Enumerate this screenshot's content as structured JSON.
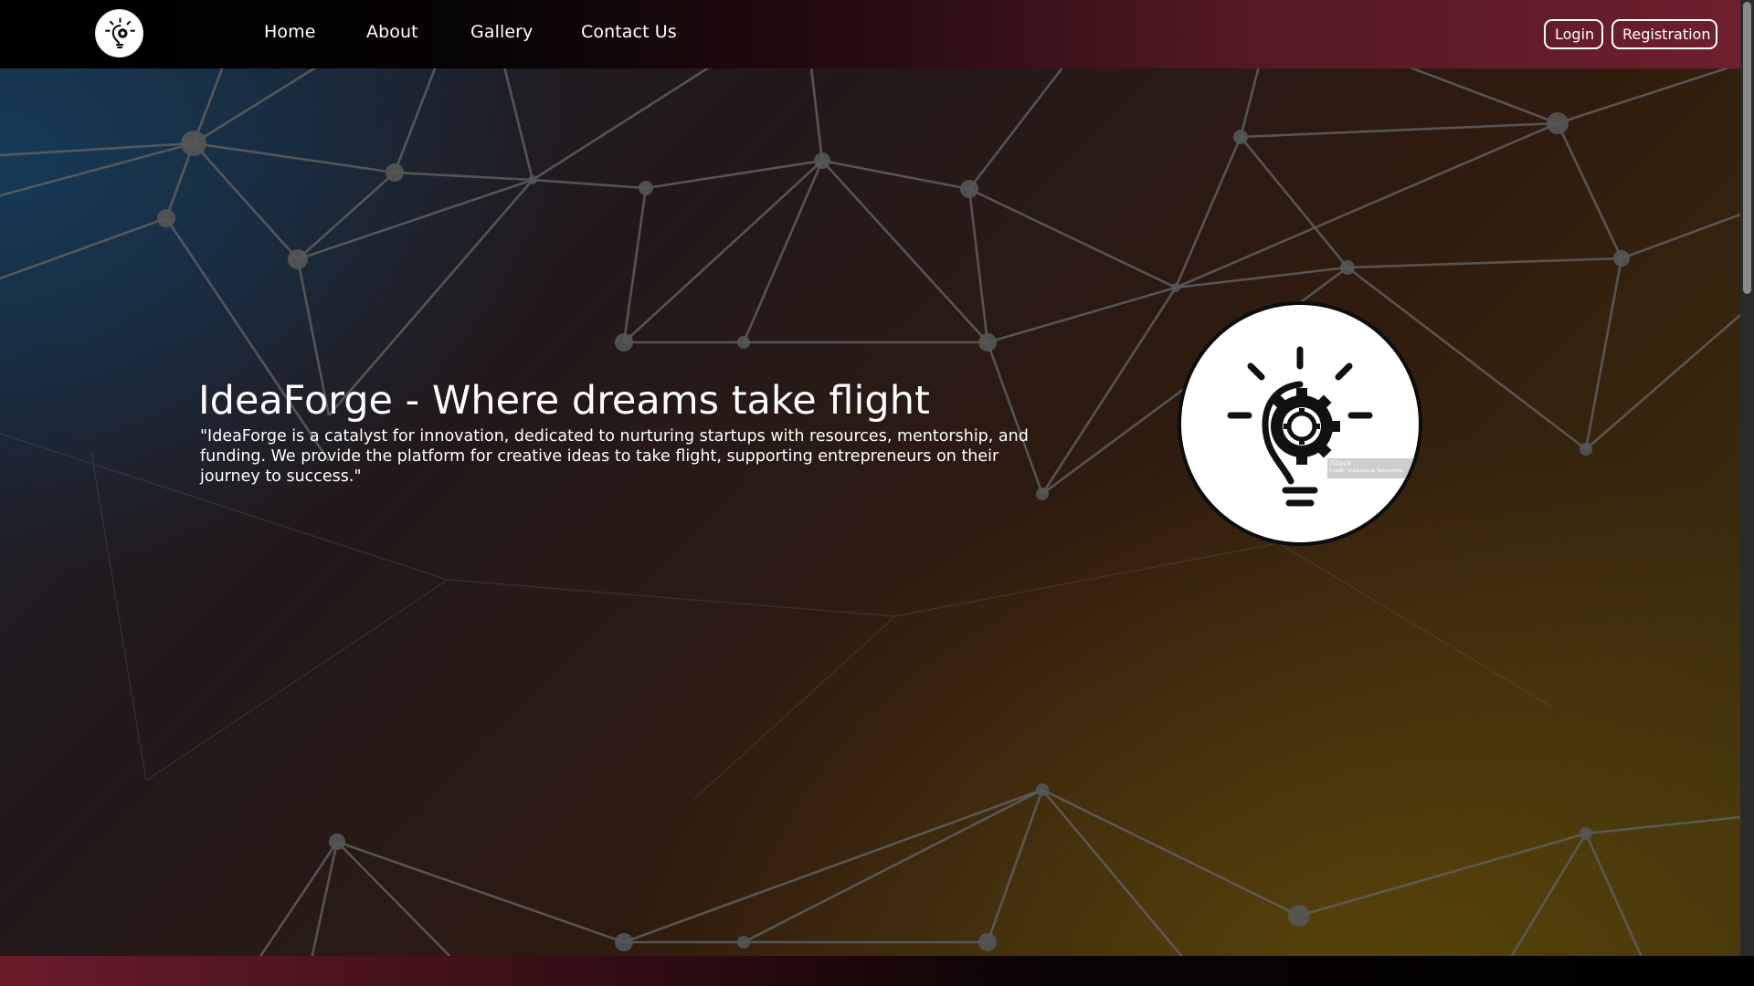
{
  "header": {
    "logo_icon": "lightbulb-gear-icon",
    "nav": [
      {
        "label": "Home"
      },
      {
        "label": "About"
      },
      {
        "label": "Gallery"
      },
      {
        "label": "Contact Us"
      }
    ],
    "login_label": "Login",
    "registration_label": "Registration"
  },
  "hero": {
    "title": "IdeaForge - Where dreams take flight",
    "description": "\"IdeaForge is a catalyst for innovation, dedicated to nurturing startups with resources, mentorship, and funding. We provide the platform for creative ideas to take flight, supporting entrepreneurs on their journey to success.\"",
    "image_icon": "lightbulb-gear-icon",
    "watermark_title": "iStock",
    "watermark_credit": "Credit: Vladyslava Yakovenko"
  },
  "colors": {
    "nav_start": "#000000",
    "nav_end": "#6e1f2c",
    "text": "#ffffff"
  }
}
